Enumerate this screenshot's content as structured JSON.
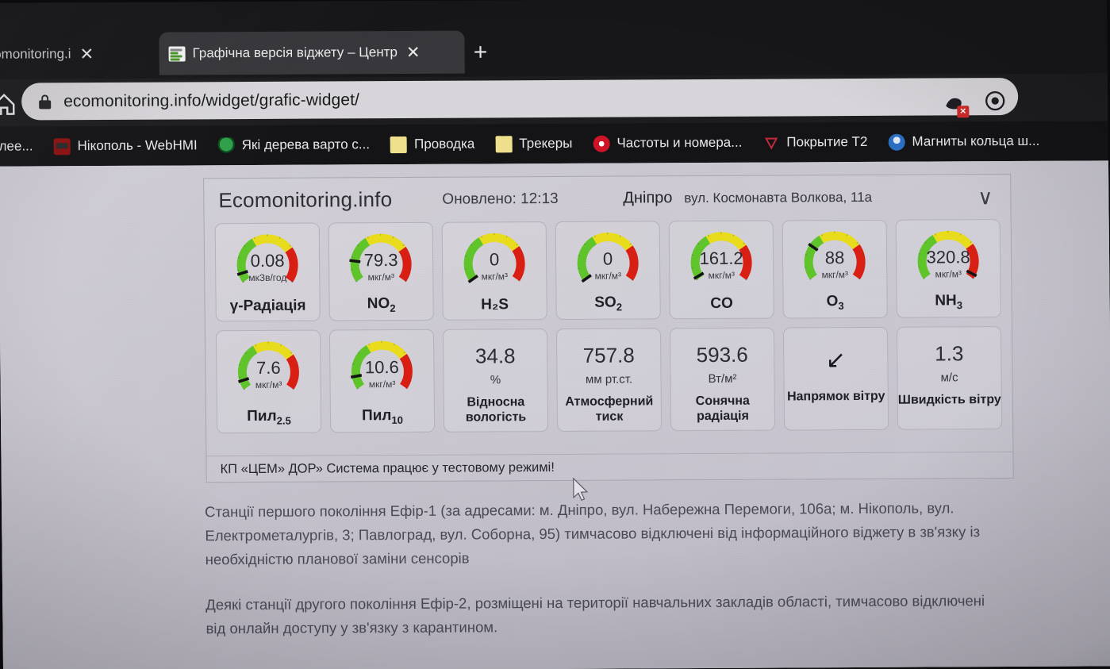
{
  "browser": {
    "tabs": [
      {
        "title": "ad.ecomonitoring.i",
        "close": "✕",
        "active": false
      },
      {
        "title": "Графічна версія віджету – Центр",
        "close": "✕",
        "active": true
      }
    ],
    "new_tab_label": "+",
    "url": "ecomonitoring.info/widget/grafic-widget/",
    "url_scheme_icon": "lock-icon",
    "extension_badge": "✕",
    "bookmarks": [
      {
        "label": "елее...",
        "icon": "none"
      },
      {
        "label": "Нікополь - WebHMI",
        "icon": "webhmi"
      },
      {
        "label": "Які дерева варто с...",
        "icon": "tree"
      },
      {
        "label": "Проводка",
        "icon": "folder"
      },
      {
        "label": "Трекеры",
        "icon": "folder"
      },
      {
        "label": "Частоты и номера...",
        "icon": "opera"
      },
      {
        "label": "Покрытие Т2",
        "icon": "t2"
      },
      {
        "label": "Магниты кольца ш...",
        "icon": "magnet"
      }
    ]
  },
  "widget": {
    "brand": "Ecomonitoring.info",
    "updated_label": "Оновлено: 12:13",
    "city": "Дніпро",
    "address": "вул. Космонавта Волкова, 11а",
    "chevron": "∨",
    "footer": "КП «ЦЕМ» ДОР» Система працює у тестовому режимі!",
    "colors": {
      "green": "#5fc52a",
      "yellow": "#e8dc1c",
      "red": "#d91f14",
      "needle": "#141414"
    }
  },
  "chart_data": {
    "type": "gauge-dashboard",
    "title": "Ecomonitoring.info — Дніпро, вул. Космонавта Волкова, 11а",
    "gauge_scale_zones": [
      {
        "color": "#5fc52a",
        "from_deg": 0,
        "to_deg": 95
      },
      {
        "color": "#e8dc1c",
        "from_deg": 95,
        "to_deg": 180
      },
      {
        "color": "#d91f14",
        "from_deg": 180,
        "to_deg": 250
      }
    ],
    "gauges": [
      {
        "name": "γ-Радіація",
        "name_sub": "",
        "value": "0.08",
        "unit": "мкЗв/год",
        "needle_frac": 0.07
      },
      {
        "name": "NO",
        "name_sub": "2",
        "value": "79.3",
        "unit": "мкг/м³",
        "needle_frac": 0.17
      },
      {
        "name": "H₂S",
        "name_sub": "",
        "value": "0",
        "unit": "мкг/м³",
        "needle_frac": 0.0
      },
      {
        "name": "SO",
        "name_sub": "2",
        "value": "0",
        "unit": "мкг/м³",
        "needle_frac": 0.0
      },
      {
        "name": "CO",
        "name_sub": "",
        "value": "161.2",
        "unit": "мкг/м³",
        "needle_frac": 0.02
      },
      {
        "name": "O",
        "name_sub": "3",
        "value": "88",
        "unit": "мкг/м³",
        "needle_frac": 0.28
      },
      {
        "name": "NH",
        "name_sub": "3",
        "value": "320.8",
        "unit": "мкг/м³",
        "needle_frac": 0.97
      },
      {
        "name": "Пил",
        "name_sub": "2.5",
        "value": "7.6",
        "unit": "мкг/м³",
        "needle_frac": 0.07
      },
      {
        "name": "Пил",
        "name_sub": "10",
        "value": "10.6",
        "unit": "мкг/м³",
        "needle_frac": 0.1
      }
    ],
    "readouts": [
      {
        "value": "34.8",
        "unit": "%",
        "name": "Відносна вологість"
      },
      {
        "value": "757.8",
        "unit": "мм рт.ст.",
        "name": "Атмосферний тиск"
      },
      {
        "value": "593.6",
        "unit": "Вт/м²",
        "name": "Сонячна радіація"
      }
    ],
    "wind": {
      "direction": {
        "arrow": "↙",
        "name": "Напрямок вітру",
        "bearing_deg": 225
      },
      "speed": {
        "value": "1.3",
        "unit": "м/с",
        "name": "Швидкість вітру"
      }
    }
  },
  "page_text": {
    "paragraph_1": "Станції першого покоління Ефір-1 (за адресами: м. Дніпро, вул. Набережна Перемоги, 106а; м. Нікополь, вул. Електрометалургів, 3; Павлоград, вул. Соборна, 95) тимчасово відключені від інформаційного віджету в зв'язку із необхідністю планової заміни сенсорів",
    "paragraph_2": "Деякі станції другого покоління Ефір-2, розміщені на території навчальних закладів області, тимчасово відключені від онлайн доступу у зв'язку з карантином."
  }
}
